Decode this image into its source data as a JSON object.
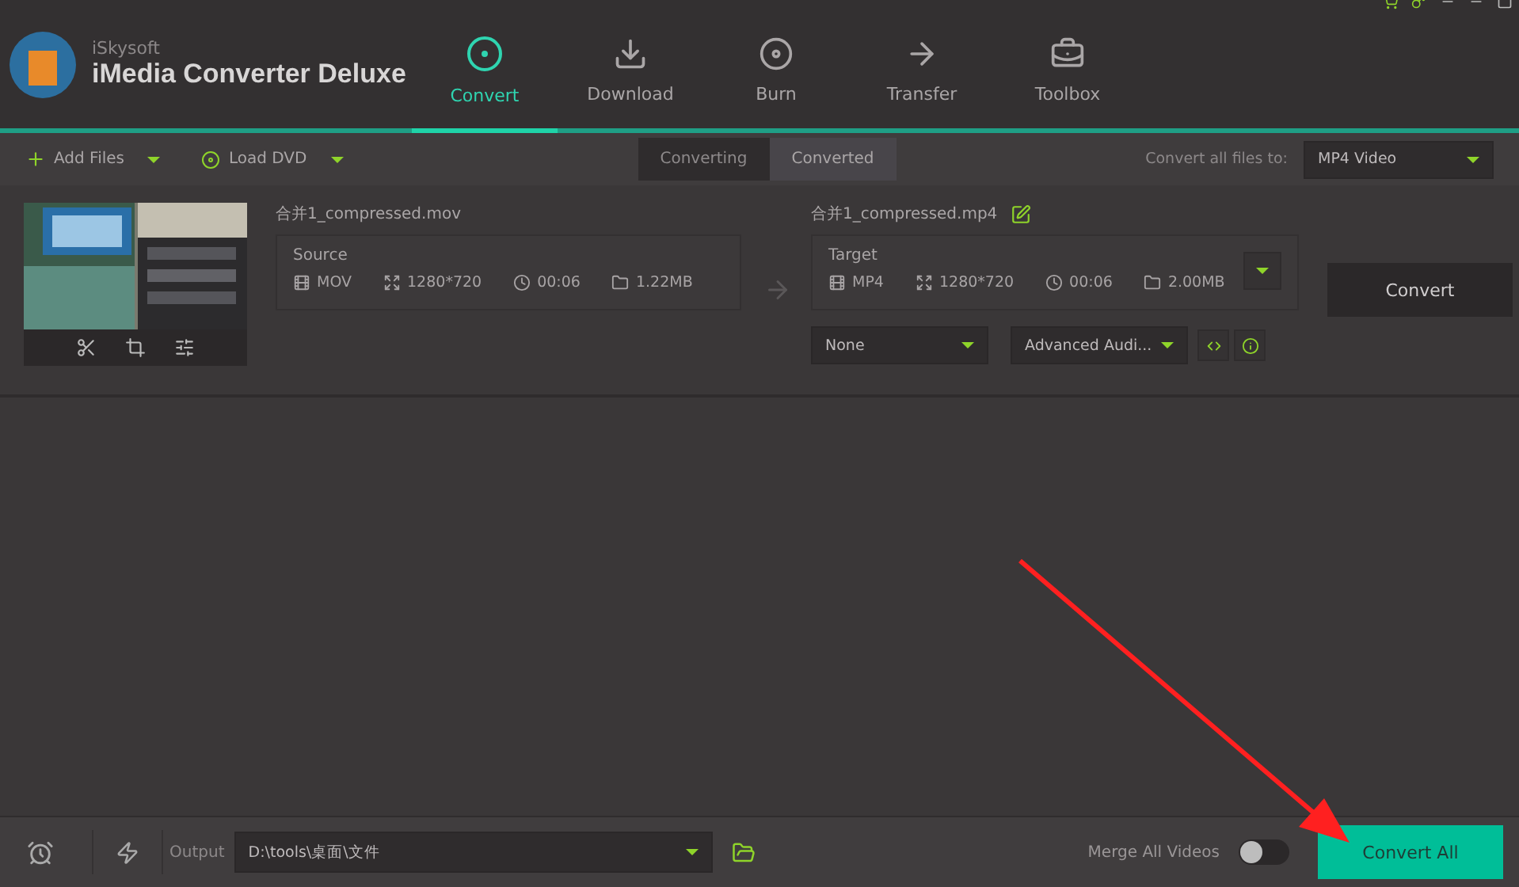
{
  "app": {
    "brand": "iSkysoft",
    "title": "iMedia Converter Deluxe"
  },
  "nav": [
    {
      "label": "Convert",
      "kind": "convert",
      "selected": true
    },
    {
      "label": "Download",
      "kind": "download",
      "selected": false
    },
    {
      "label": "Burn",
      "kind": "burn",
      "selected": false
    },
    {
      "label": "Transfer",
      "kind": "transfer",
      "selected": false
    },
    {
      "label": "Toolbox",
      "kind": "toolbox",
      "selected": false
    }
  ],
  "toolbar": {
    "add_files": "Add Files",
    "load_dvd": "Load DVD",
    "tabs": [
      {
        "label": "Converting",
        "selected": true
      },
      {
        "label": "Converted",
        "selected": false
      }
    ],
    "convert_all_label": "Convert all files to:",
    "format": "MP4 Video"
  },
  "file": {
    "source_name": "合并1_compressed.mov",
    "source_label": "Source",
    "source": {
      "format": "MOV",
      "resolution": "1280*720",
      "duration": "00:06",
      "size": "1.22MB"
    },
    "target_name": "合并1_compressed.mp4",
    "target_label": "Target",
    "target": {
      "format": "MP4",
      "resolution": "1280*720",
      "duration": "00:06",
      "size": "2.00MB"
    },
    "subtitle": "None",
    "audio": "Advanced Audi...",
    "convert": "Convert"
  },
  "bottom": {
    "output_label": "Output",
    "output_path": "D:\\tools\\桌面\\文件",
    "merge_label": "Merge All Videos",
    "merge_on": false,
    "convert_all": "Convert All"
  }
}
